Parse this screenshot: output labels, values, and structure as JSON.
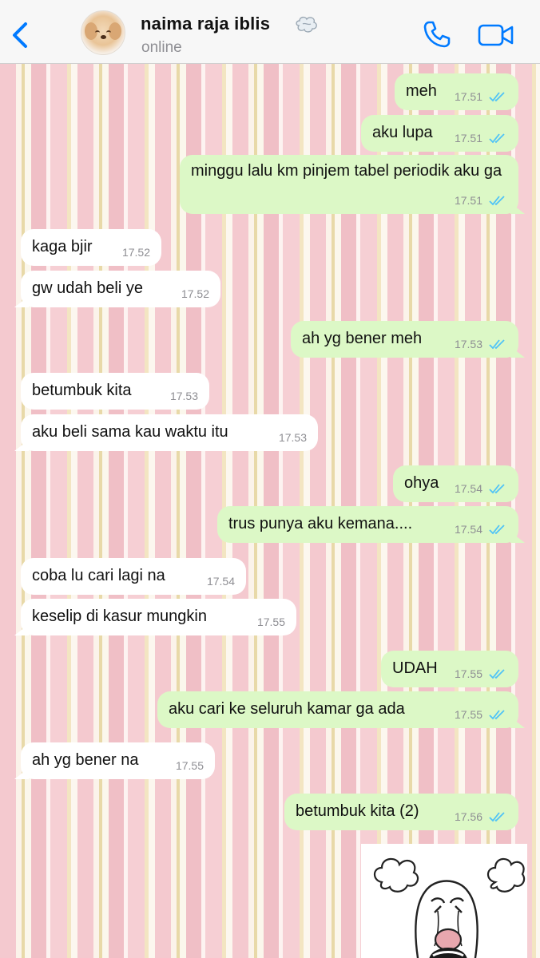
{
  "header": {
    "contact_name": "naima raja iblis",
    "status": "online",
    "emoji_icon": "dashing-away-icon",
    "colors": {
      "accent": "#007aff",
      "header_bg": "#f7f7f7"
    }
  },
  "messages": [
    {
      "dir": "out",
      "text": "meh",
      "time": "17.51",
      "read": true
    },
    {
      "dir": "out",
      "text": "aku lupa",
      "time": "17.51",
      "read": true
    },
    {
      "dir": "out",
      "text": "minggu lalu km pinjem tabel periodik aku ga",
      "time": "17.51",
      "read": true
    },
    {
      "dir": "in",
      "text": "kaga bjir",
      "time": "17.52"
    },
    {
      "dir": "in",
      "text": "gw udah beli ye",
      "time": "17.52"
    },
    {
      "dir": "out",
      "text": "ah yg bener meh",
      "time": "17.53",
      "read": true
    },
    {
      "dir": "in",
      "text": "betumbuk kita",
      "time": "17.53"
    },
    {
      "dir": "in",
      "text": "aku beli sama kau waktu itu",
      "time": "17.53"
    },
    {
      "dir": "out",
      "text": "ohya",
      "time": "17.54",
      "read": true
    },
    {
      "dir": "out",
      "text": "trus punya aku kemana....",
      "time": "17.54",
      "read": true
    },
    {
      "dir": "in",
      "text": "coba lu cari lagi na",
      "time": "17.54"
    },
    {
      "dir": "in",
      "text": "keselip di kasur mungkin",
      "time": "17.55"
    },
    {
      "dir": "out",
      "text": "UDAH",
      "time": "17.55",
      "read": true
    },
    {
      "dir": "out",
      "text": "aku cari ke seluruh kamar ga ada",
      "time": "17.55",
      "read": true
    },
    {
      "dir": "in",
      "text": "ah yg bener na",
      "time": "17.55"
    },
    {
      "dir": "out",
      "text": "betumbuk kita (2)",
      "time": "17.56",
      "read": true
    }
  ],
  "colors": {
    "outgoing_bubble": "#dcf8c6",
    "incoming_bubble": "#ffffff",
    "read_ticks": "#4fc3f7",
    "wallpaper": "pink-cream-vertical-stripes"
  },
  "sticker": {
    "icon": "angry-crying-meme-sticker"
  }
}
